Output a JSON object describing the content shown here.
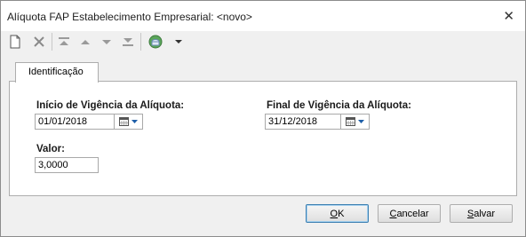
{
  "window": {
    "title": "Alíquota FAP Estabelecimento Empresarial: <novo>",
    "close_glyph": "✕"
  },
  "toolbar": {
    "icons": [
      "new-document-icon",
      "delete-icon",
      "first-record-icon",
      "previous-record-icon",
      "next-record-icon",
      "last-record-icon",
      "database-icon",
      "dropdown-arrow-icon"
    ]
  },
  "tabs": [
    {
      "label": "Identificação"
    }
  ],
  "form": {
    "inicio": {
      "label": "Início de Vigência da Alíquota:",
      "value": "01/01/2018"
    },
    "final": {
      "label": "Final de Vigência da Alíquota:",
      "value": "31/12/2018"
    },
    "valor": {
      "label": "Valor:",
      "value": "3,0000"
    }
  },
  "buttons": {
    "ok": {
      "mnemonic": "O",
      "rest": "K"
    },
    "cancelar": {
      "mnemonic": "C",
      "rest": "ancelar"
    },
    "salvar": {
      "mnemonic": "S",
      "rest": "alvar"
    }
  },
  "colors": {
    "accent": "#3c7fb1",
    "panel_bg": "#ffffff",
    "window_bg": "#f0f0f0"
  }
}
